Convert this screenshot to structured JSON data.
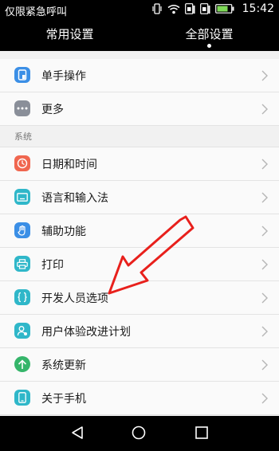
{
  "status_bar": {
    "carrier": "仅限紧急呼叫",
    "time": "15:42"
  },
  "tabs": [
    {
      "label": "常用设置"
    },
    {
      "label": "全部设置"
    }
  ],
  "rows_top": [
    {
      "label": "单手操作",
      "icon": "one-hand-icon",
      "color": "#3b8fe6"
    },
    {
      "label": "更多",
      "icon": "more-dots-icon",
      "color": "#8a8f99"
    }
  ],
  "section_title": "系统",
  "rows_system": [
    {
      "label": "日期和时间",
      "icon": "clock-icon",
      "color": "#f0664f"
    },
    {
      "label": "语言和输入法",
      "icon": "keyboard-icon",
      "color": "#2fb7c9"
    },
    {
      "label": "辅助功能",
      "icon": "hand-icon",
      "color": "#3b8fe6"
    },
    {
      "label": "打印",
      "icon": "printer-icon",
      "color": "#2fb7c9"
    },
    {
      "label": "开发人员选项",
      "icon": "braces-icon",
      "color": "#2fb7c9"
    },
    {
      "label": "用户体验改进计划",
      "icon": "user-icon",
      "color": "#2fb7c9"
    },
    {
      "label": "系统更新",
      "icon": "arrow-up-icon",
      "color": "#35b56a"
    },
    {
      "label": "关于手机",
      "icon": "phone-icon",
      "color": "#2fb7c9"
    }
  ],
  "accent": {
    "arrow": "#e8201c"
  }
}
